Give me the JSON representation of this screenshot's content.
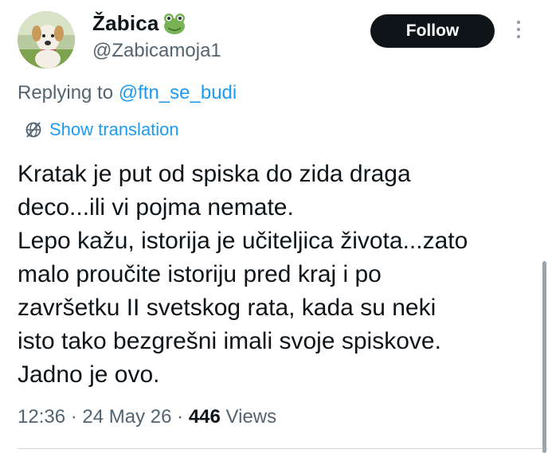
{
  "author": {
    "display_name": "Žabica",
    "handle": "@Zabicamoja1",
    "emoji_icon": "frog-face-icon",
    "avatar_icon": "dog-photo-avatar"
  },
  "actions": {
    "follow_label": "Follow",
    "more_icon": "more-vertical-icon"
  },
  "reply": {
    "prefix": "Replying to",
    "mention": "@ftn_se_budi"
  },
  "translation": {
    "label": "Show translation",
    "icon": "globe-icon"
  },
  "tweet": {
    "text": "Kratak je put od spiska do zida draga\ndeco...ili vi pojma nemate.\nLepo kažu, istorija je učiteljica života...zato\nmalo proučite istoriju pred kraj i po\nzavršetku II svetskog rata, kada su neki\nisto tako bezgrešni imali svoje spiskove.\nJadno je ovo."
  },
  "meta": {
    "time": "12:36",
    "separator": "·",
    "date": "24 May 26",
    "views_count": "446",
    "views_label": "Views"
  },
  "colors": {
    "link": "#1d9bf0",
    "secondary_text": "#536471",
    "primary_text": "#0f1419",
    "follow_bg": "#0f1419"
  }
}
